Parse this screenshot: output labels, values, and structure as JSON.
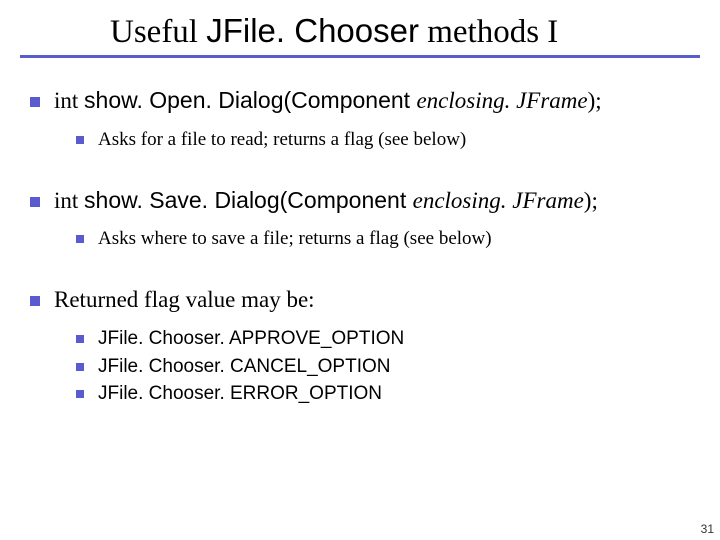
{
  "title": {
    "part1": "Useful ",
    "part2_sans": "JFile. Chooser",
    "part3": " methods I"
  },
  "bullets": {
    "b1_prefix": "int ",
    "b1_sans": "show. Open. Dialog(Component ",
    "b1_ital": "enclosing. JFrame",
    "b1_suffix": ");",
    "b1_sub": "Asks for a file to read; returns a flag (see below)",
    "b2_prefix": "int ",
    "b2_sans": "show. Save. Dialog(Component ",
    "b2_ital": "enclosing. JFrame",
    "b2_suffix": ");",
    "b2_sub": "Asks where to save a file; returns a flag (see below)",
    "b3": "Returned flag value may be:",
    "b3_subs": [
      "JFile. Chooser. APPROVE_OPTION",
      "JFile. Chooser. CANCEL_OPTION",
      "JFile. Chooser. ERROR_OPTION"
    ]
  },
  "pagenum": "31"
}
